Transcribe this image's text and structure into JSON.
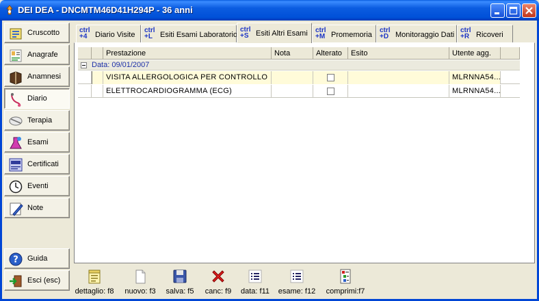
{
  "window": {
    "title": "DEI DEA - DNCMTM46D41H294P - 36 anni",
    "colors": {
      "titlebar": "#0054e3",
      "close": "#d8492b",
      "face": "#ece9d8"
    }
  },
  "nav": {
    "items": [
      {
        "label": "Cruscotto",
        "icon": "dashboard-icon",
        "active": false
      },
      {
        "label": "Anagrafe",
        "icon": "registry-icon",
        "active": false
      },
      {
        "label": "Anamnesi",
        "icon": "history-book-icon",
        "active": false
      },
      {
        "label": "Diario",
        "icon": "diary-icon",
        "active": true
      },
      {
        "label": "Terapia",
        "icon": "pill-icon",
        "active": false
      },
      {
        "label": "Esami",
        "icon": "lab-exam-icon",
        "active": false
      },
      {
        "label": "Certificati",
        "icon": "certificate-icon",
        "active": false
      },
      {
        "label": "Eventi",
        "icon": "calendar-clock-icon",
        "active": false
      },
      {
        "label": "Note",
        "icon": "note-pencil-icon",
        "active": false
      }
    ],
    "guida": {
      "label": "Guida",
      "icon": "help-icon"
    },
    "esci": {
      "label": "Esci (esc)",
      "icon": "exit-icon"
    }
  },
  "tabs": [
    {
      "key_top": "ctrl",
      "key_bottom": "+4",
      "label": "Diario Visite",
      "active": false
    },
    {
      "key_top": "ctrl",
      "key_bottom": "+L",
      "label": "Esiti Esami Laboratorio",
      "active": false
    },
    {
      "key_top": "ctrl",
      "key_bottom": "+S",
      "label": "Esiti Altri Esami",
      "active": true
    },
    {
      "key_top": "ctrl",
      "key_bottom": "+M",
      "label": "Promemoria",
      "active": false
    },
    {
      "key_top": "ctrl",
      "key_bottom": "+D",
      "label": "Monitoraggio Dati",
      "active": false
    },
    {
      "key_top": "ctrl",
      "key_bottom": "+R",
      "label": "Ricoveri",
      "active": false
    }
  ],
  "grid": {
    "columns": [
      "",
      "",
      "Prestazione",
      "Nota",
      "Alterato",
      "Esito",
      "Utente agg.",
      ""
    ],
    "group": "Data: 09/01/2007",
    "rows": [
      {
        "prestazione": "VISITA ALLERGOLOGICA PER CONTROLLO",
        "nota": "",
        "alterato": false,
        "esito": "",
        "utente": "MLRNNA54...",
        "selected": true
      },
      {
        "prestazione": "ELETTROCARDIOGRAMMA (ECG)",
        "nota": "",
        "alterato": false,
        "esito": "",
        "utente": "MLRNNA54...",
        "selected": false
      }
    ]
  },
  "toolbar": {
    "buttons": [
      {
        "label": "dettaglio: f8",
        "icon": "detail-icon"
      },
      {
        "label": "nuovo: f3",
        "icon": "new-document-icon"
      },
      {
        "label": "salva: f5",
        "icon": "save-icon"
      },
      {
        "label": "canc: f9",
        "icon": "delete-icon"
      },
      {
        "label": "data: f11",
        "icon": "list-icon"
      },
      {
        "label": "esame: f12",
        "icon": "list-icon"
      },
      {
        "label": "comprimi:f7",
        "icon": "collapse-icon"
      }
    ]
  }
}
